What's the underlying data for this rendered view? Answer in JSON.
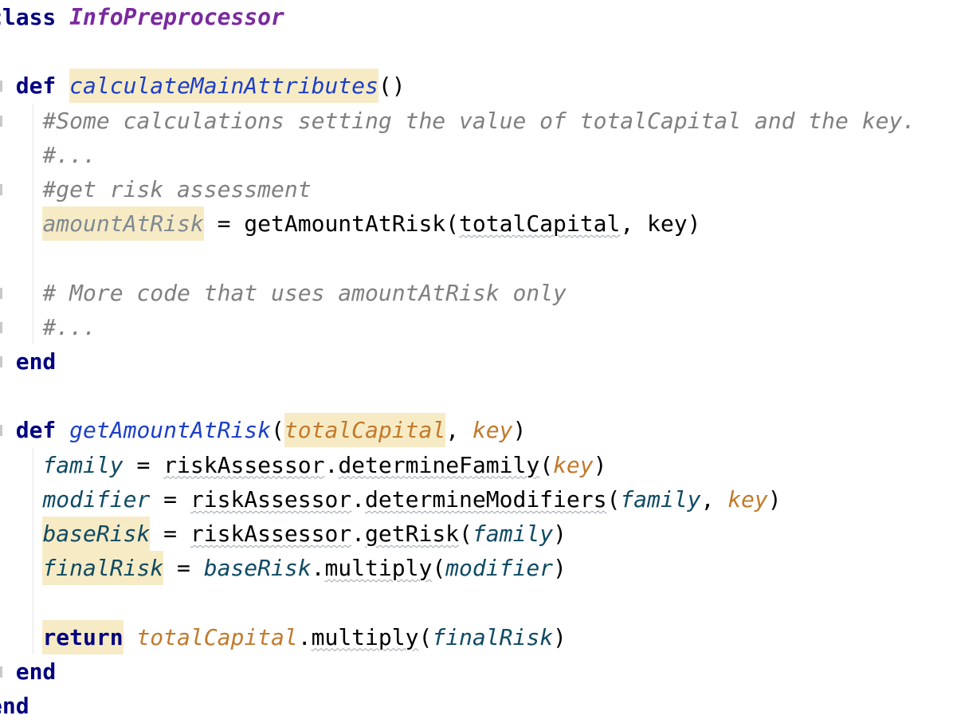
{
  "editor": {
    "lines": [
      {
        "tokens": [
          {
            "text": "class",
            "cls": "kw"
          },
          {
            "text": " "
          },
          {
            "text": "InfoPreprocessor",
            "cls": "cls"
          }
        ]
      },
      {
        "tokens": []
      },
      {
        "tokens": [
          {
            "text": "  "
          },
          {
            "text": "def",
            "cls": "kw"
          },
          {
            "text": " "
          },
          {
            "text": "calculateMainAttributes",
            "cls": "fn hl"
          },
          {
            "text": "()"
          }
        ]
      },
      {
        "tokens": [
          {
            "text": "    "
          },
          {
            "text": "#Some calculations setting the value of totalCapital and the key.",
            "cls": "cmt"
          }
        ]
      },
      {
        "tokens": [
          {
            "text": "    "
          },
          {
            "text": "#...",
            "cls": "cmt"
          }
        ]
      },
      {
        "tokens": [
          {
            "text": "    "
          },
          {
            "text": "#get risk assessment",
            "cls": "cmt"
          }
        ]
      },
      {
        "tokens": [
          {
            "text": "    "
          },
          {
            "text": "amountAtRisk",
            "cls": "ivar hl"
          },
          {
            "text": " = getAmountAtRisk("
          },
          {
            "text": "totalCapital",
            "cls": "squig"
          },
          {
            "text": ", key)"
          }
        ]
      },
      {
        "tokens": []
      },
      {
        "tokens": [
          {
            "text": "    "
          },
          {
            "text": "# More code that uses amountAtRisk only",
            "cls": "cmt"
          }
        ]
      },
      {
        "tokens": [
          {
            "text": "    "
          },
          {
            "text": "#...",
            "cls": "cmt"
          }
        ]
      },
      {
        "tokens": [
          {
            "text": "  "
          },
          {
            "text": "end",
            "cls": "kw"
          }
        ]
      },
      {
        "tokens": []
      },
      {
        "tokens": [
          {
            "text": "  "
          },
          {
            "text": "def",
            "cls": "kw"
          },
          {
            "text": " "
          },
          {
            "text": "getAmountAtRisk",
            "cls": "fn"
          },
          {
            "text": "("
          },
          {
            "text": "totalCapital",
            "cls": "param hl"
          },
          {
            "text": ", "
          },
          {
            "text": "key",
            "cls": "param"
          },
          {
            "text": ")"
          }
        ]
      },
      {
        "tokens": [
          {
            "text": "    "
          },
          {
            "text": "family",
            "cls": "lvar"
          },
          {
            "text": " = "
          },
          {
            "text": "riskAssessor",
            "cls": "squig"
          },
          {
            "text": "."
          },
          {
            "text": "determineFamily",
            "cls": "squig"
          },
          {
            "text": "("
          },
          {
            "text": "key",
            "cls": "param"
          },
          {
            "text": ")"
          }
        ]
      },
      {
        "tokens": [
          {
            "text": "    "
          },
          {
            "text": "modifier",
            "cls": "lvar"
          },
          {
            "text": " = "
          },
          {
            "text": "riskAssessor",
            "cls": "squig"
          },
          {
            "text": "."
          },
          {
            "text": "determineModifiers",
            "cls": "squig"
          },
          {
            "text": "("
          },
          {
            "text": "family",
            "cls": "lvar"
          },
          {
            "text": ", "
          },
          {
            "text": "key",
            "cls": "param"
          },
          {
            "text": ")"
          }
        ]
      },
      {
        "tokens": [
          {
            "text": "    "
          },
          {
            "text": "baseRisk",
            "cls": "lvar hl"
          },
          {
            "text": " = "
          },
          {
            "text": "riskAssessor",
            "cls": "squig"
          },
          {
            "text": "."
          },
          {
            "text": "getRisk",
            "cls": "squig"
          },
          {
            "text": "("
          },
          {
            "text": "family",
            "cls": "lvar"
          },
          {
            "text": ")"
          }
        ]
      },
      {
        "tokens": [
          {
            "text": "    "
          },
          {
            "text": "finalRisk",
            "cls": "lvar hl"
          },
          {
            "text": " = "
          },
          {
            "text": "baseRisk",
            "cls": "lvar"
          },
          {
            "text": "."
          },
          {
            "text": "multiply",
            "cls": "squig"
          },
          {
            "text": "("
          },
          {
            "text": "modifier",
            "cls": "lvar"
          },
          {
            "text": ")"
          }
        ]
      },
      {
        "tokens": []
      },
      {
        "tokens": [
          {
            "text": "    "
          },
          {
            "text": "return",
            "cls": "kw hl"
          },
          {
            "text": " "
          },
          {
            "text": "totalCapital",
            "cls": "param"
          },
          {
            "text": "."
          },
          {
            "text": "multiply",
            "cls": "squig"
          },
          {
            "text": "("
          },
          {
            "text": "finalRisk",
            "cls": "lvar"
          },
          {
            "text": ")"
          }
        ]
      },
      {
        "tokens": [
          {
            "text": "  "
          },
          {
            "text": "end",
            "cls": "kw"
          }
        ]
      },
      {
        "tokens": [
          {
            "text": "end",
            "cls": "kw"
          }
        ]
      }
    ]
  }
}
